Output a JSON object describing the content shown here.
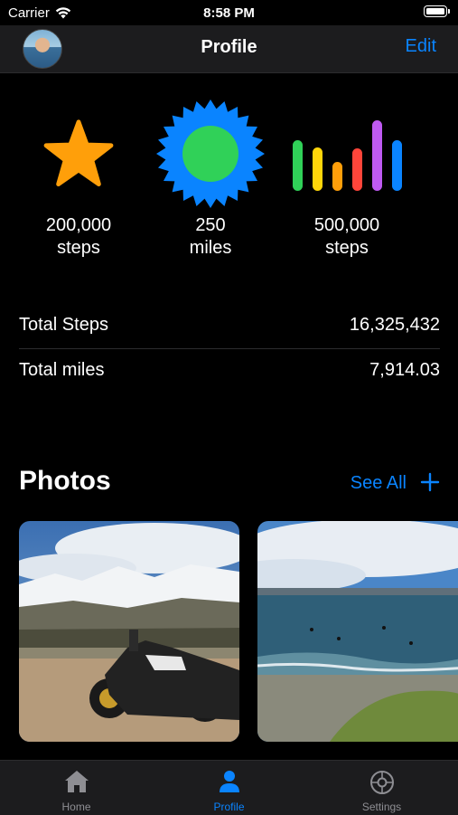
{
  "status_bar": {
    "carrier": "Carrier",
    "time": "8:58 PM"
  },
  "nav": {
    "title": "Profile",
    "edit_label": "Edit"
  },
  "badges": [
    {
      "icon": "star-icon",
      "color": "#ff9f0a",
      "line1": "200,000",
      "line2": "steps"
    },
    {
      "icon": "sun-badge-icon",
      "colors": [
        "#0a84ff",
        "#30d158"
      ],
      "line1": "250",
      "line2": "miles"
    },
    {
      "icon": "bars-icon",
      "colors": [
        "#30d158",
        "#ffd60a",
        "#ff9f0a",
        "#ff453a",
        "#bf5af2",
        "#0a84ff"
      ],
      "line1": "500,000",
      "line2": "steps"
    }
  ],
  "stats": [
    {
      "label": "Total Steps",
      "value": "16,325,432"
    },
    {
      "label": "Total miles",
      "value": "7,914.03"
    }
  ],
  "photos": {
    "title": "Photos",
    "see_all_label": "See All",
    "add_icon": "plus-icon"
  },
  "tab_bar": {
    "tabs": [
      {
        "label": "Home",
        "icon": "house-icon",
        "active": false
      },
      {
        "label": "Profile",
        "icon": "person-icon",
        "active": true
      },
      {
        "label": "Settings",
        "icon": "gear-icon",
        "active": false
      }
    ]
  },
  "colors": {
    "accent": "#0a84ff",
    "background": "#000000",
    "bar": "#1c1c1e",
    "inactive": "#8e8e93"
  }
}
